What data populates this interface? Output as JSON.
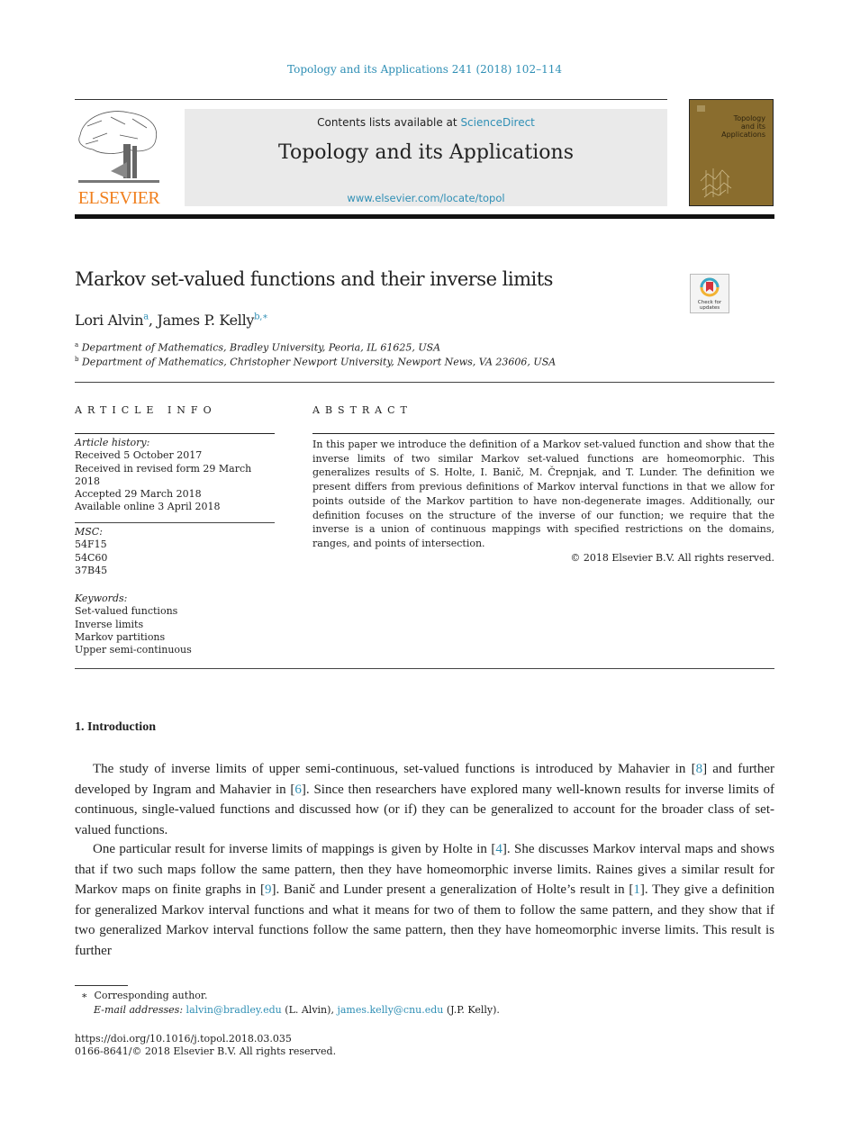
{
  "header": {
    "journal_ref": "Topology and its Applications 241 (2018) 102–114",
    "contents_prefix": "Contents lists available at ",
    "sciencedirect": "ScienceDirect",
    "journal_title": "Topology and its Applications",
    "journal_url": "www.elsevier.com/locate/topol",
    "publisher": "ELSEVIER",
    "cover_title_lines": [
      "Topology",
      "and its",
      "Applications"
    ],
    "crossmark_label_1": "Check for",
    "crossmark_label_2": "updates"
  },
  "article": {
    "title": "Markov set-valued functions and their inverse limits",
    "authors": [
      {
        "name": "Lori Alvin",
        "sup": "a"
      },
      {
        "name": "James P. Kelly",
        "sup": "b,∗"
      }
    ],
    "author_separator": ", ",
    "affiliations": [
      {
        "sup": "a",
        "text": "Department of Mathematics, Bradley University, Peoria, IL 61625, USA"
      },
      {
        "sup": "b",
        "text": "Department of Mathematics, Christopher Newport University, Newport News, VA 23606, USA"
      }
    ]
  },
  "article_info": {
    "heading": "ARTICLE INFO",
    "history_label": "Article history:",
    "history": [
      "Received 5 October 2017",
      "Received in revised form 29 March 2018",
      "Accepted 29 March 2018",
      "Available online 3 April 2018"
    ],
    "msc_label": "MSC:",
    "msc": [
      "54F15",
      "54C60",
      "37B45"
    ],
    "keywords_label": "Keywords:",
    "keywords": [
      "Set-valued functions",
      "Inverse limits",
      "Markov partitions",
      "Upper semi-continuous"
    ]
  },
  "abstract": {
    "heading": "ABSTRACT",
    "text": "In this paper we introduce the definition of a Markov set-valued function and show that the inverse limits of two similar Markov set-valued functions are homeomorphic. This generalizes results of S. Holte, I. Banič, M. Črepnjak, and T. Lunder. The definition we present differs from previous definitions of Markov interval functions in that we allow for points outside of the Markov partition to have non-degenerate images. Additionally, our definition focuses on the structure of the inverse of our function; we require that the inverse is a union of continuous mappings with specified restrictions on the domains, ranges, and points of intersection.",
    "copyright": "© 2018 Elsevier B.V. All rights reserved."
  },
  "body": {
    "section_heading": "1.  Introduction",
    "para1": [
      {
        "t": "The study of inverse limits of upper semi-continuous, set-valued functions is introduced by Mahavier in "
      },
      {
        "ref": "[8]"
      },
      {
        "t": " and further developed by Ingram and Mahavier in "
      },
      {
        "ref": "[6]"
      },
      {
        "t": ". Since then researchers have explored many well-known results for inverse limits of continuous, single-valued functions and discussed how (or if) they can be generalized to account for the broader class of set-valued functions."
      }
    ],
    "para2": [
      {
        "t": "One particular result for inverse limits of mappings is given by Holte in "
      },
      {
        "ref": "[4]"
      },
      {
        "t": ". She discusses Markov interval maps and shows that if two such maps follow the same pattern, then they have homeomorphic inverse limits. Raines gives a similar result for Markov maps on finite graphs in "
      },
      {
        "ref": "[9]"
      },
      {
        "t": ". Banič and Lunder present a generalization of Holte’s result in "
      },
      {
        "ref": "[1]"
      },
      {
        "t": ". They give a definition for generalized Markov interval functions and what it means for two of them to follow the same pattern, and they show that if two generalized Markov interval functions follow the same pattern, then they have homeomorphic inverse limits. This result is further"
      }
    ]
  },
  "footnotes": {
    "star": "∗",
    "corresponding": "Corresponding author.",
    "email_label": "E-mail addresses:",
    "email1": "lalvin@bradley.edu",
    "email1_owner": " (L. Alvin), ",
    "email2": "james.kelly@cnu.edu",
    "email2_owner": " (J.P. Kelly).",
    "doi": "https://doi.org/10.1016/j.topol.2018.03.035",
    "issn": "0166-8641/© 2018 Elsevier B.V. All rights reserved."
  }
}
